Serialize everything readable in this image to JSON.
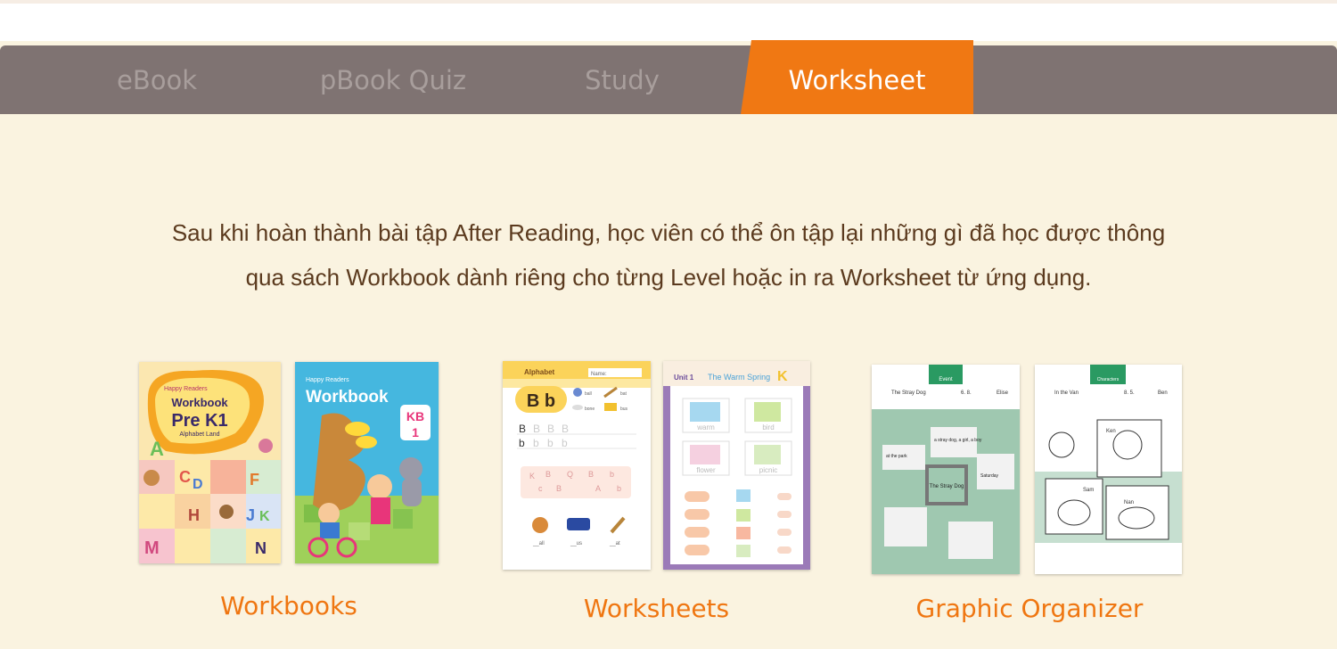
{
  "tabs": [
    {
      "label": "eBook",
      "active": false
    },
    {
      "label": "pBook Quiz",
      "active": false
    },
    {
      "label": "Study",
      "active": false
    },
    {
      "label": "Worksheet",
      "active": true
    }
  ],
  "description": {
    "line1": "Sau khi hoàn thành bài tập After Reading, học viên có thể ôn tập lại những gì đã học được thông",
    "line2": "qua sách Workbook dành riêng cho từng Level hoặc in ra Worksheet từ ứng dụng."
  },
  "sections": [
    {
      "caption": "Workbooks"
    },
    {
      "caption": "Worksheets"
    },
    {
      "caption": "Graphic Organizer"
    }
  ],
  "books": {
    "prek1": {
      "series": "Happy Readers",
      "title1": "Workbook",
      "title2": "Pre K1",
      "subtitle": "Alphabet Land"
    },
    "kb1": {
      "series": "Happy Readers",
      "title": "Workbook",
      "level": "KB",
      "level_num": "1"
    }
  },
  "worksheet_alphabet": {
    "header": "Alphabet",
    "name_label": "Name:",
    "letters": "B b",
    "words": [
      "ball",
      "bat",
      "bone",
      "bus"
    ],
    "blanks": [
      "__all",
      "__us",
      "__at"
    ]
  },
  "worksheet_unit": {
    "unit": "Unit 1",
    "title": "The Warm Spring",
    "words": [
      "warm",
      "bird",
      "flower",
      "picnic"
    ]
  },
  "organizer1": {
    "header": "Event",
    "title_value": "The Stray Dog",
    "date_value": "6. 8.",
    "name_value": "Elise",
    "center": "The Stray Dog",
    "notes": [
      "a stray dog, a girl, a boy",
      "at the park",
      "Saturday"
    ]
  },
  "organizer2": {
    "header": "Characters",
    "title_value": "In the Van",
    "date_value": "8. 5.",
    "name_value": "Ben",
    "names": [
      "Ken",
      "Sam",
      "Nan"
    ]
  },
  "colors": {
    "accent": "#f07813",
    "tabbar": "#7f7372",
    "background": "#faf3e0",
    "text": "#5b3a1e"
  }
}
